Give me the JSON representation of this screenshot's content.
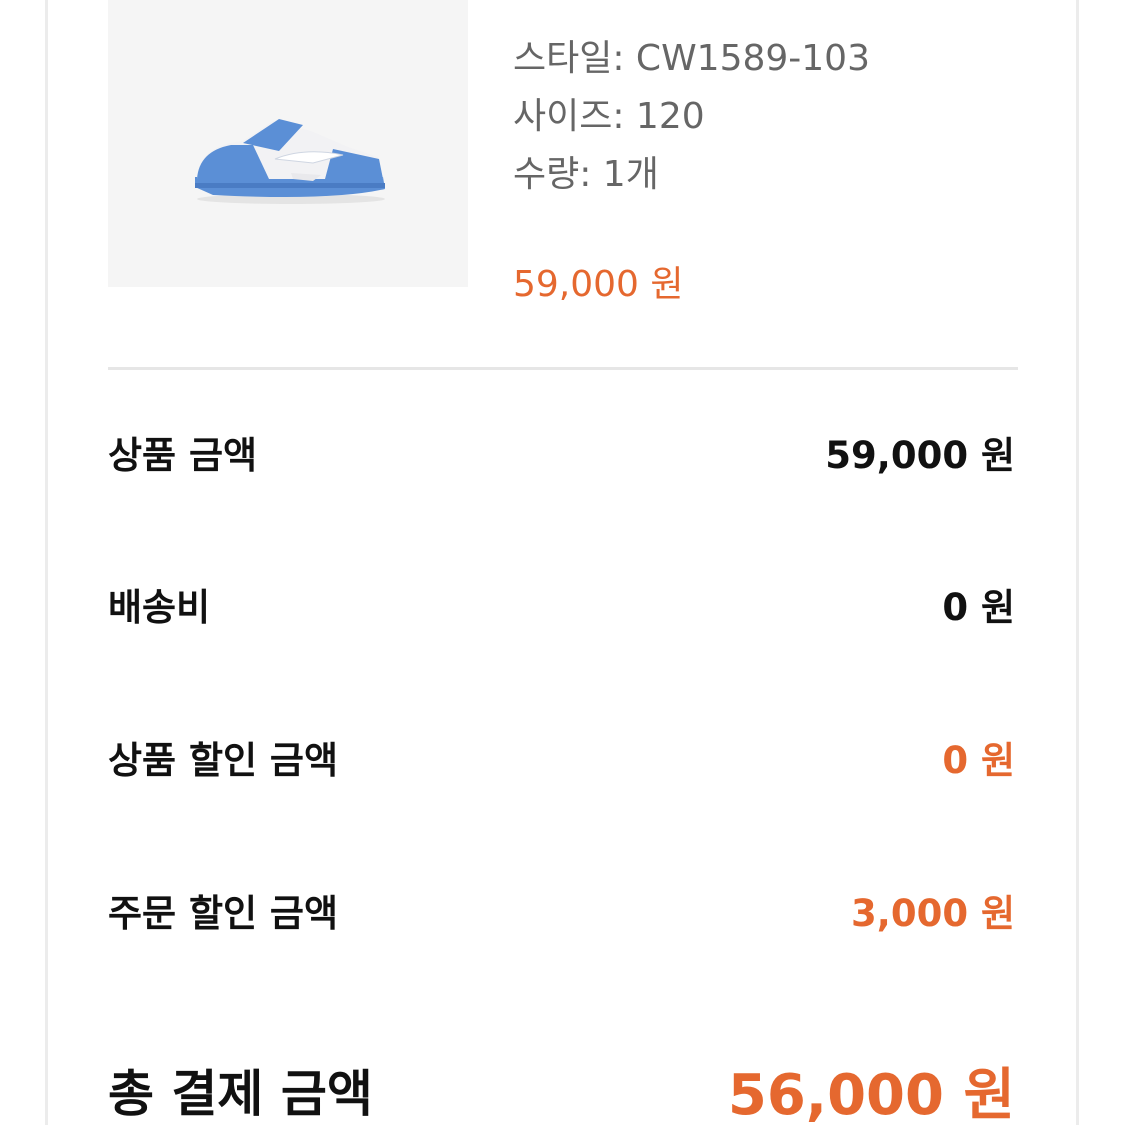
{
  "product": {
    "image_icon": "sneaker-icon",
    "style_line": "스타일: CW1589-103",
    "size_line": "사이즈: 120",
    "quantity_line": "수량: 1개",
    "price": "59,000 원"
  },
  "summary": {
    "rows": [
      {
        "label": "상품 금액",
        "value": "59,000 원"
      },
      {
        "label": "배송비",
        "value": "0 원"
      },
      {
        "label": "상품 할인 금액",
        "value": "0 원"
      },
      {
        "label": "주문 할인 금액",
        "value": "3,000 원"
      }
    ],
    "total": {
      "label": "총 결제 금액",
      "value": "56,000 원"
    }
  },
  "colors": {
    "accent": "#e5682f",
    "text": "#111111",
    "muted": "#666666",
    "shoe_blue": "#5b8fd6"
  }
}
